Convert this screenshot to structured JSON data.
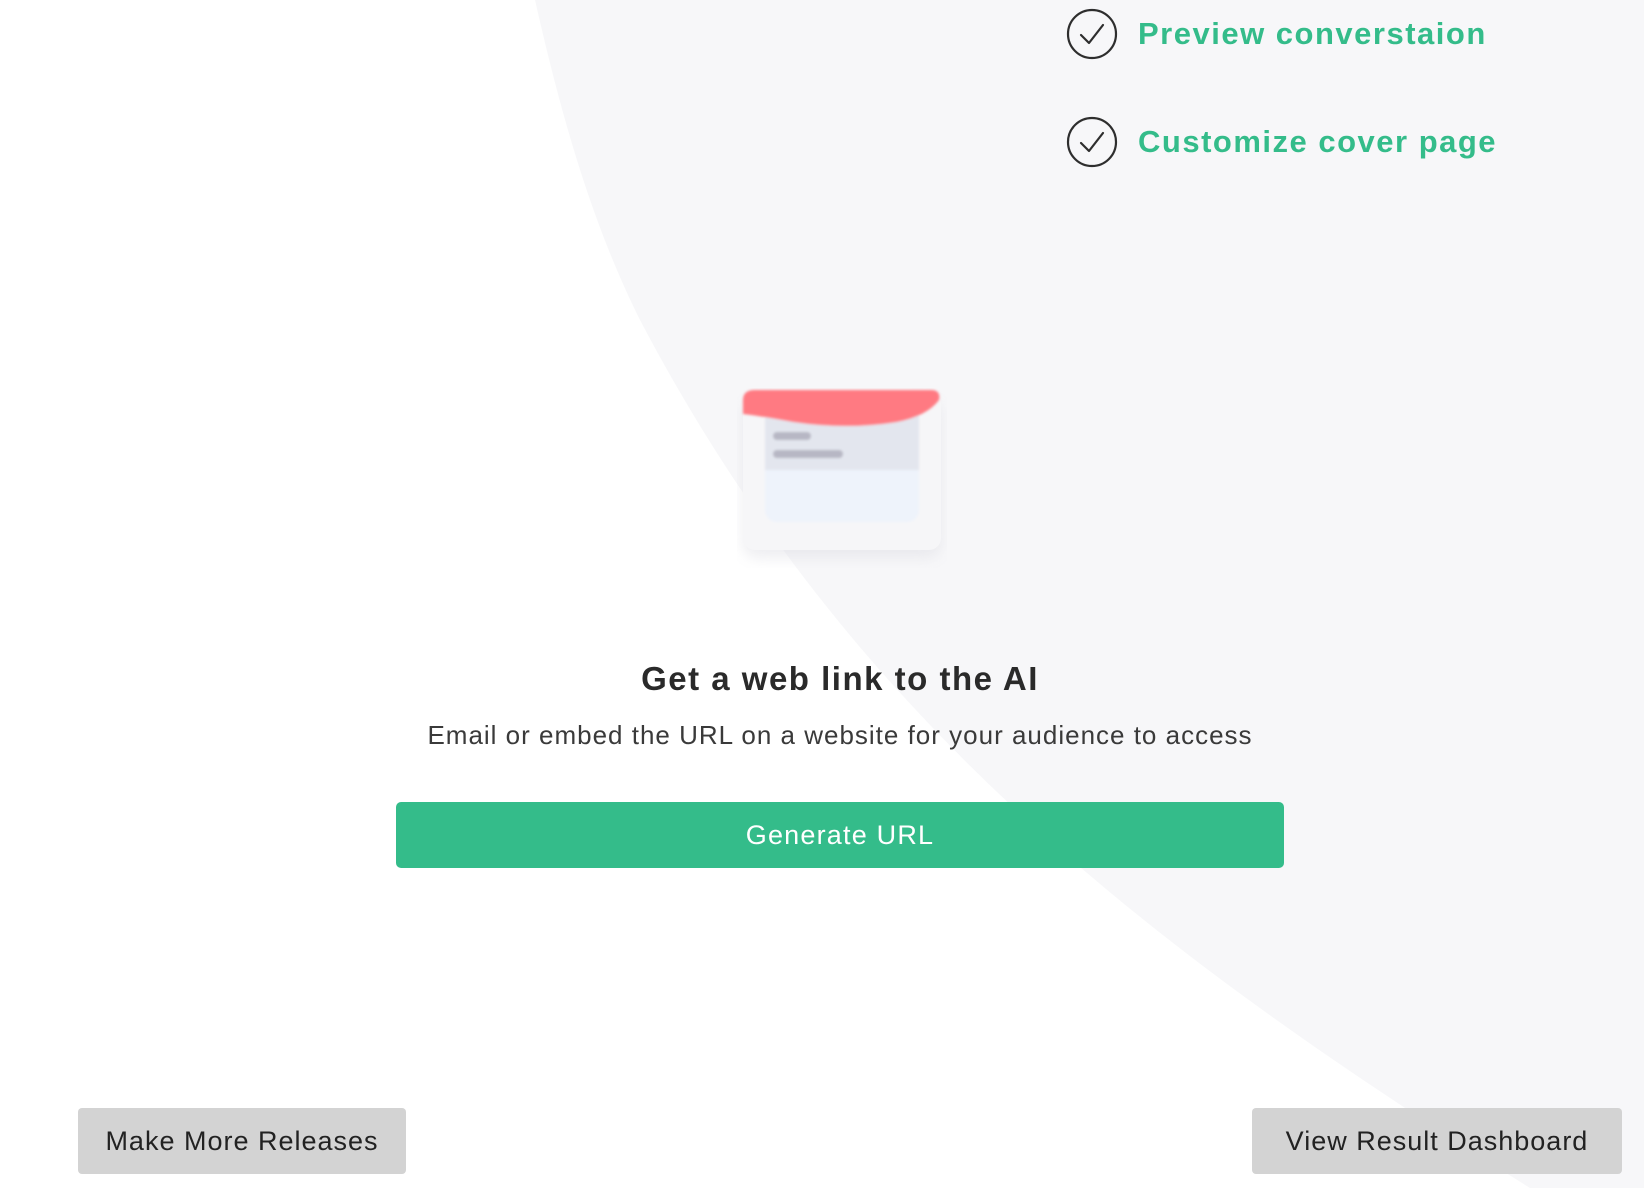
{
  "checklist": {
    "items": [
      {
        "label": "Preview converstaion",
        "icon": "check-circle-icon"
      },
      {
        "label": "Customize cover page",
        "icon": "check-circle-icon"
      }
    ]
  },
  "hero": {
    "illustration_icon": "web-link-card-icon",
    "title": "Get a web link to the AI",
    "subtitle": "Email or embed the URL on a website for your audience to access"
  },
  "actions": {
    "generate_label": "Generate URL",
    "make_more_label": "Make More Releases",
    "dashboard_label": "View Result Dashboard"
  },
  "colors": {
    "accent": "#34bc8a",
    "background_shape": "#f7f7f9",
    "card_header": "#ff7a82",
    "secondary_button": "#d3d3d3"
  }
}
